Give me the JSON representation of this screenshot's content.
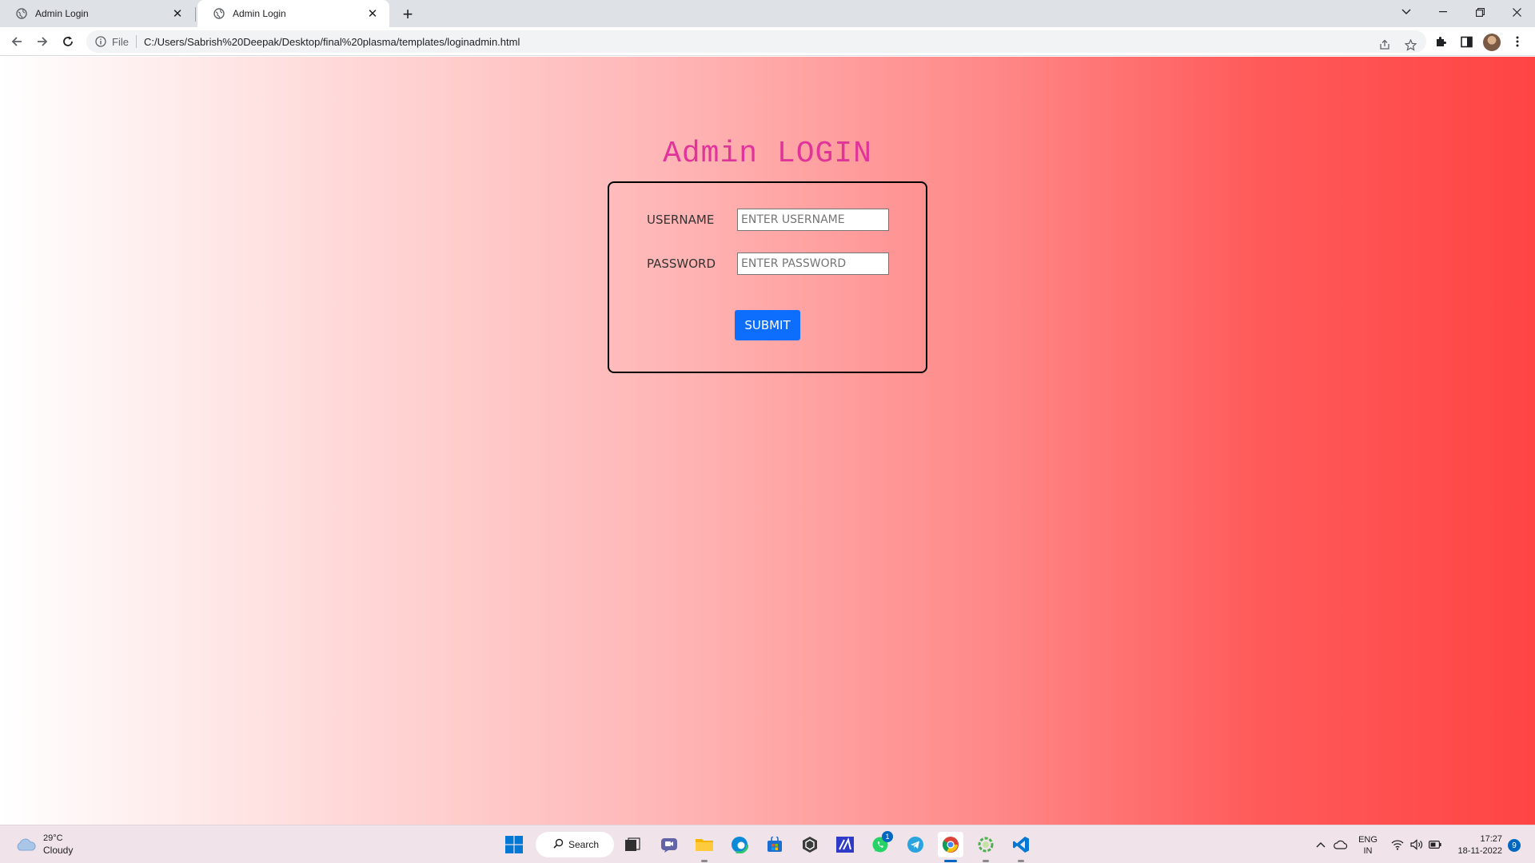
{
  "browser": {
    "tabs": [
      {
        "title": "Admin Login",
        "active": false
      },
      {
        "title": "Admin Login",
        "active": true
      }
    ],
    "address": {
      "scheme_label": "File",
      "url": "C:/Users/Sabrish%20Deepak/Desktop/final%20plasma/templates/loginadmin.html"
    }
  },
  "page": {
    "title": "Admin LOGIN",
    "username_label": "USERNAME",
    "username_placeholder": "ENTER USERNAME",
    "password_label": "PASSWORD",
    "password_placeholder": "ENTER PASSWORD",
    "submit_label": "SUBMIT",
    "colors": {
      "title": "#e0349a",
      "submit": "#0d6efd",
      "gradient_start": "#ffffff",
      "gradient_end": "#ff4444"
    }
  },
  "taskbar": {
    "weather": {
      "temp": "29°C",
      "condition": "Cloudy"
    },
    "search_label": "Search",
    "whatsapp_badge": "1",
    "language": {
      "line1": "ENG",
      "line2": "IN"
    },
    "clock": {
      "time": "17:27",
      "date": "18-11-2022"
    },
    "notification_count": "9"
  }
}
